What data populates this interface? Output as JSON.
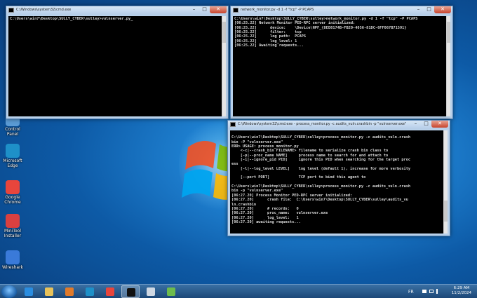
{
  "desktop_icons": [
    {
      "label": "Control\nPanel",
      "icon": "control-panel-icon",
      "color": "#5b9bd5"
    },
    {
      "label": "Microsoft\nEdge",
      "icon": "edge-icon",
      "color": "#1e90c8"
    },
    {
      "label": "Google\nChrome",
      "icon": "chrome-icon",
      "color": "#e8453c"
    },
    {
      "label": "MiniTool\nInstaller",
      "icon": "installer-icon",
      "color": "#d94040"
    },
    {
      "label": "Wireshark",
      "icon": "wireshark-icon",
      "color": "#3a7ad9"
    }
  ],
  "windows": {
    "left_cmd": {
      "title": "C:\\Windows\\system32\\cmd.exe",
      "lines": [
        "C:\\Users\\win7\\Desktop\\SULLY_CYBER\\sulley>vulnserver.py_"
      ]
    },
    "network_monitor": {
      "title": "network_monitor.py  -d 1 -f \"tcp\" -P PCAPS",
      "lines": [
        "C:\\Users\\win7\\Desktop\\SULLY_CYBER\\sulley>network_monitor.py -d 1 -f \"tcp\" -P PCAPS",
        "[06:25.22] Network Monitor PED-RPC server initialized:",
        "[06:25.22]      device:    \\Device\\NPF_{8ED8174B-FB20-4056-81DC-6FF067B71591}",
        "[06:25.22]      filter:    tcp",
        "[06:25.22]      log path:  PCAPS",
        "[06:25.22]      log_level: 1",
        "[06:25.22] Awaiting requests..."
      ]
    },
    "process_monitor": {
      "title": "C:\\Windows\\system32\\cmd.exe - process_monitor.py  -c audits_vuln.crashbin -p \"vulnserver.exe\"",
      "lines": [
        "",
        "C:\\Users\\win7\\Desktop\\SULLY_CYBER\\sulley>process_monitor.py -c audits_vuln.crash",
        "bin -P \"vulnserver.exe\"",
        "ERR> USAGE: process_monitor.py",
        "    <-c|--crash_bin FILENAME> filename to serialize crash bin class to",
        "    [-p|--proc_name NAME]     process name to search for and attach to",
        "    [-i|--ignore_pid PID]     ignore this PID when searching for the target proc",
        "ess",
        "    [-l|--log_level LEVEL]    log level (default 1), increase for more verbosity",
        "",
        "    [--port PORT]             TCP port to bind this agent to",
        "",
        "C:\\Users\\win7\\Desktop\\SULLY_CYBER\\sulley>process_monitor.py -c audits_vuln.crash",
        "bin -p \"vulnserver.exe\"",
        "[06:27.20] Process Monitor PED-RPC server initialized:",
        "[06:27.20]      crash file:  C:\\Users\\win7\\Desktop\\SULLY_CYBER\\sulley\\audits_vu",
        "ln.crashbin",
        "[06:27.20]      # records:   0",
        "[06:27.20]      proc_name:   vulnserver.exe",
        "[06:27.20]      log_level:   1",
        "[06:27.20] awaiting requests..."
      ]
    }
  },
  "taskbar": {
    "items": [
      {
        "name": "ie-icon",
        "color": "#2a8de0",
        "active": false
      },
      {
        "name": "explorer-icon",
        "color": "#e8c25a",
        "active": false
      },
      {
        "name": "media-player-icon",
        "color": "#e07a2a",
        "active": false
      },
      {
        "name": "edge-icon",
        "color": "#1e90c8",
        "active": false
      },
      {
        "name": "chrome-icon",
        "color": "#e8453c",
        "active": false
      },
      {
        "name": "cmd-icon",
        "color": "#111111",
        "active": true
      },
      {
        "name": "window-icon",
        "color": "#cfd8e3",
        "active": false
      },
      {
        "name": "paint-icon",
        "color": "#6dbb4c",
        "active": false
      }
    ],
    "language": "FR",
    "time": "6:29 AM",
    "date": "11/2/2024"
  }
}
